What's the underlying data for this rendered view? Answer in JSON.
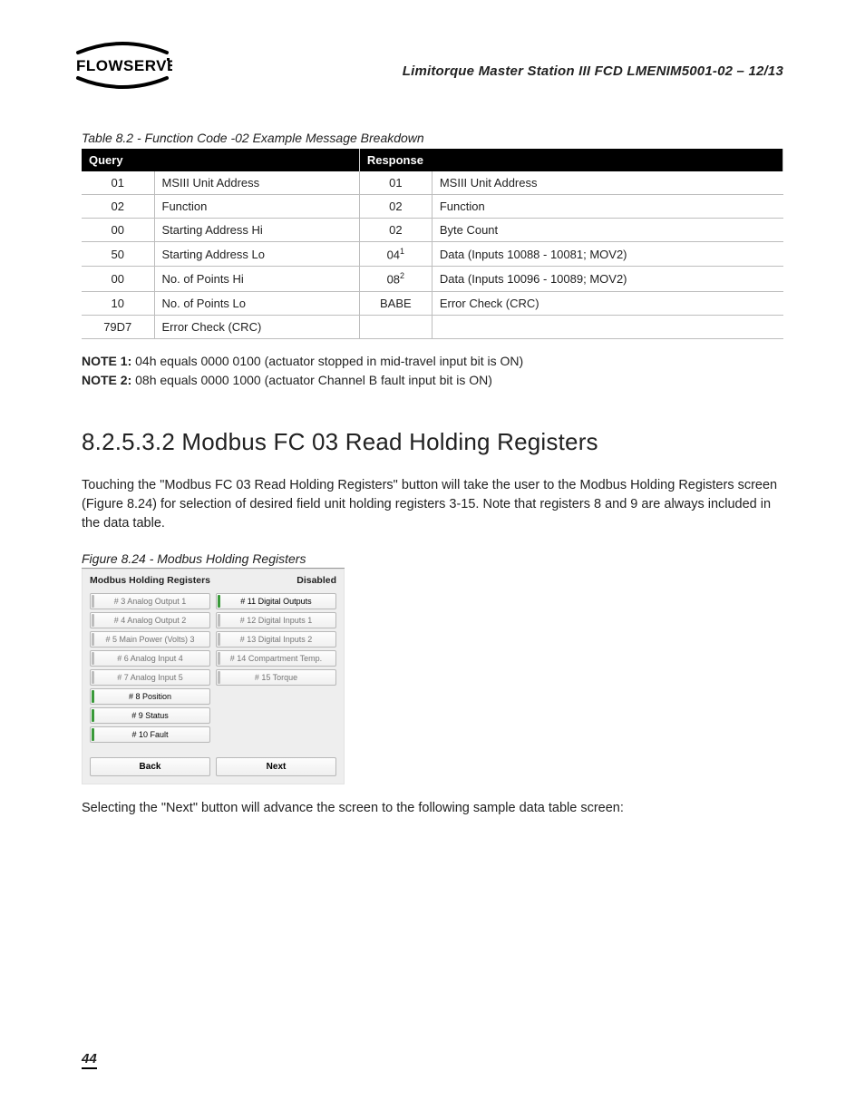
{
  "header": {
    "doc_title": "Limitorque Master Station III    FCD LMENIM5001-02 – 12/13"
  },
  "table": {
    "caption": "Table 8.2 - Function Code -02 Example Message Breakdown",
    "col_query": "Query",
    "col_response": "Response",
    "rows": [
      {
        "qc": "01",
        "qd": "MSIII Unit Address",
        "rc": "01",
        "rd": "MSIII Unit Address"
      },
      {
        "qc": "02",
        "qd": "Function",
        "rc": "02",
        "rd": "Function"
      },
      {
        "qc": "00",
        "qd": "Starting Address Hi",
        "rc": "02",
        "rd": "Byte Count"
      },
      {
        "qc": "50",
        "qd": "Starting Address Lo",
        "rc": "04",
        "rs": "1",
        "rd": "Data (Inputs 10088 - 10081; MOV2)"
      },
      {
        "qc": "00",
        "qd": "No. of Points Hi",
        "rc": "08",
        "rs": "2",
        "rd": "Data (Inputs 10096 - 10089; MOV2)"
      },
      {
        "qc": "10",
        "qd": "No. of Points Lo",
        "rc": "BABE",
        "rd": "Error Check (CRC)"
      },
      {
        "qc": "79D7",
        "qd": "Error Check (CRC)",
        "rc": "",
        "rd": ""
      }
    ]
  },
  "notes": {
    "n1_label": "NOTE 1:",
    "n1_text": " 04h equals 0000 0100 (actuator stopped in mid-travel input bit is ON)",
    "n2_label": "NOTE 2:",
    "n2_text": " 08h equals 0000 1000 (actuator Channel B fault input bit is ON)"
  },
  "section": {
    "heading": "8.2.5.3.2 Modbus FC 03 Read Holding Registers",
    "para1": "Touching the \"Modbus FC 03 Read Holding Registers\" button will take the user to the Modbus Holding Registers screen (Figure 8.24) for selection of desired field unit holding registers 3-15. Note that registers 8 and 9 are always included in the data table.",
    "figure_caption": "Figure 8.24 - Modbus Holding Registers",
    "para2": "Selecting the \"Next\" button will advance the screen to the following sample data table screen:"
  },
  "screenshot": {
    "title": "Modbus Holding Registers",
    "status": "Disabled",
    "left": [
      {
        "label": "# 3 Analog Output 1",
        "enabled": false
      },
      {
        "label": "# 4 Analog Output 2",
        "enabled": false
      },
      {
        "label": "# 5 Main Power (Volts) 3",
        "enabled": false
      },
      {
        "label": "# 6 Analog Input 4",
        "enabled": false
      },
      {
        "label": "# 7 Analog Input 5",
        "enabled": false
      },
      {
        "label": "# 8 Position",
        "enabled": true
      },
      {
        "label": "# 9 Status",
        "enabled": true
      },
      {
        "label": "# 10 Fault",
        "enabled": true
      }
    ],
    "right": [
      {
        "label": "# 11 Digital Outputs",
        "enabled": true
      },
      {
        "label": "# 12 Digital Inputs 1",
        "enabled": false
      },
      {
        "label": "# 13 Digital Inputs 2",
        "enabled": false
      },
      {
        "label": "# 14 Compartment Temp.",
        "enabled": false
      },
      {
        "label": "# 15 Torque",
        "enabled": false
      }
    ],
    "back": "Back",
    "next": "Next"
  },
  "page_number": "44"
}
